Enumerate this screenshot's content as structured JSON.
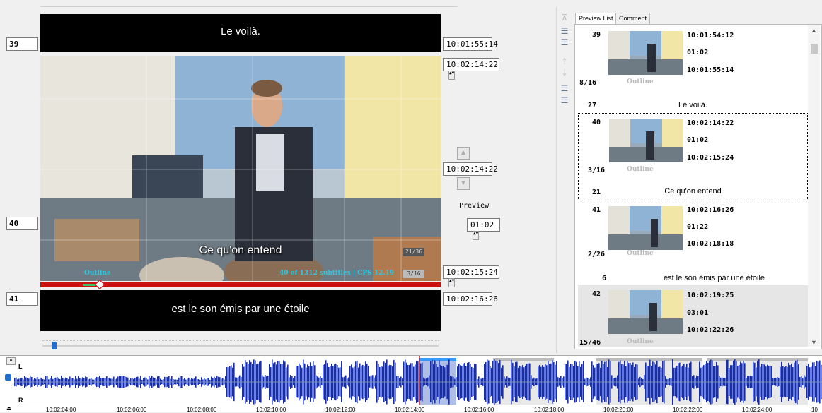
{
  "editor": {
    "prev_index": "39",
    "prev_text": "Le voilà.",
    "prev_end": "10:01:55:14",
    "cur_start": "10:02:14:22",
    "cur_index": "40",
    "cur_mid": "10:02:14:22",
    "preview_label": "Preview",
    "preview_duration": "01:02",
    "cur_end": "10:02:15:24",
    "next_index": "41",
    "next_text": "est le son émis par une étoile",
    "next_start": "10:02:16:26"
  },
  "video": {
    "subtitle": "Ce qu'on entend",
    "outline": "Outline",
    "status": "40 of 1312 subtitles | CPS 12.19",
    "badge_top": "21/36",
    "badge_bottom": "3/16",
    "progress": 0.15
  },
  "tabs": [
    "Preview List",
    "Comment"
  ],
  "preview_list": [
    {
      "index": "39",
      "in": "10:01:54:12",
      "dur": "01:02",
      "out": "10:01:55:14",
      "ratio": "8/16",
      "outline": "Outline",
      "chars": "27",
      "text": "Le voilà.",
      "selected": false
    },
    {
      "index": "40",
      "in": "10:02:14:22",
      "dur": "01:02",
      "out": "10:02:15:24",
      "ratio": "3/16",
      "outline": "Outline",
      "chars": "21",
      "text": "Ce qu'on entend",
      "selected": true
    },
    {
      "index": "41",
      "in": "10:02:16:26",
      "dur": "01:22",
      "out": "10:02:18:18",
      "ratio": "2/26",
      "outline": "Outline",
      "chars": "6",
      "text": "est le son émis par une étoile",
      "selected": false
    },
    {
      "index": "42",
      "in": "10:02:19:25",
      "dur": "03:01",
      "out": "10:02:22:26",
      "ratio": "15/46",
      "outline": "Outline",
      "chars": "",
      "text": "",
      "selected": false
    }
  ],
  "waveform": {
    "channel_l": "L",
    "channel_r": "R",
    "ticks": [
      "10:02:04:00",
      "10:02:06:00",
      "10:02:08:00",
      "10:02:10:00",
      "10:02:12:00",
      "10:02:14:00",
      "10:02:16:00",
      "10:02:18:00",
      "10:02:20:00",
      "10:02:22:00",
      "10:02:24:00",
      "10"
    ]
  },
  "colors": {
    "wave": "#1a2e9c",
    "accent": "#3399ff",
    "progress": "#cc1111"
  }
}
